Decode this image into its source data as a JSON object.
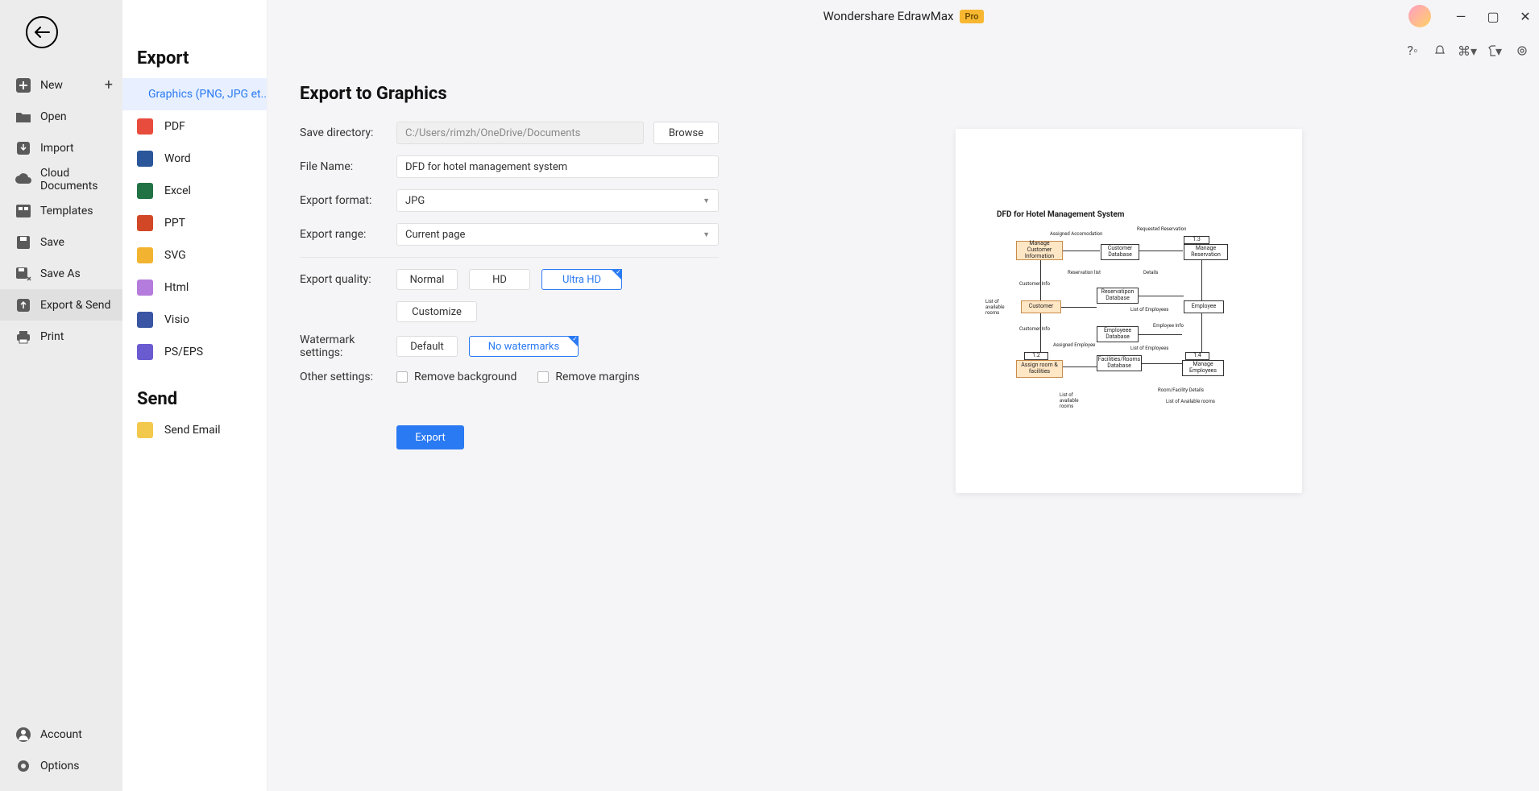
{
  "app": {
    "title": "Wondershare EdrawMax",
    "badge": "Pro"
  },
  "nav": {
    "items": [
      {
        "label": "New",
        "icon": "plus-square"
      },
      {
        "label": "Open",
        "icon": "folder"
      },
      {
        "label": "Import",
        "icon": "download"
      },
      {
        "label": "Cloud Documents",
        "icon": "cloud"
      },
      {
        "label": "Templates",
        "icon": "template"
      },
      {
        "label": "Save",
        "icon": "save"
      },
      {
        "label": "Save As",
        "icon": "save-as"
      },
      {
        "label": "Export & Send",
        "icon": "export",
        "active": true
      },
      {
        "label": "Print",
        "icon": "print"
      }
    ],
    "bottom": [
      {
        "label": "Account",
        "icon": "user"
      },
      {
        "label": "Options",
        "icon": "gear"
      }
    ]
  },
  "export_sidebar": {
    "heading": "Export",
    "formats": [
      {
        "label": "Graphics (PNG, JPG et...",
        "active": true
      },
      {
        "label": "PDF"
      },
      {
        "label": "Word"
      },
      {
        "label": "Excel"
      },
      {
        "label": "PPT"
      },
      {
        "label": "SVG"
      },
      {
        "label": "Html"
      },
      {
        "label": "Visio"
      },
      {
        "label": "PS/EPS"
      }
    ],
    "send_heading": "Send",
    "send_items": [
      {
        "label": "Send Email"
      }
    ]
  },
  "form": {
    "title": "Export to Graphics",
    "labels": {
      "save_dir": "Save directory:",
      "file_name": "File Name:",
      "export_format": "Export format:",
      "export_range": "Export range:",
      "export_quality": "Export quality:",
      "watermark": "Watermark settings:",
      "other": "Other settings:"
    },
    "values": {
      "save_dir": "C:/Users/rimzh/OneDrive/Documents",
      "file_name": "DFD for hotel management system",
      "export_format": "JPG",
      "export_range": "Current page"
    },
    "buttons": {
      "browse": "Browse",
      "customize": "Customize",
      "export": "Export"
    },
    "quality_options": {
      "normal": "Normal",
      "hd": "HD",
      "ultra_hd": "Ultra HD"
    },
    "watermark_options": {
      "default": "Default",
      "none": "No watermarks"
    },
    "checkboxes": {
      "remove_bg": "Remove background",
      "remove_margins": "Remove margins"
    }
  },
  "preview": {
    "title": "DFD for Hotel Management System",
    "boxes": {
      "manage_customer": "Manage Customer Information",
      "customer_db": "Customer Database",
      "manage_reservation": "Manage Reservation",
      "customer": "Customer",
      "reservation_db": "Reservatipon Database",
      "employee": "Employee",
      "employee_db": "Employeee Database",
      "assign_room": "Assign room & facilities",
      "facilities_db": "Facilities/Rooms Database",
      "manage_employees": "Manage Employees",
      "p13": "1.3",
      "p12": "1.2",
      "p14": "1.4"
    },
    "labels": {
      "assigned_accom": "Assigned Accomodation",
      "requested_res": "Requested Reservation",
      "reservation_list": "Reservation list",
      "customer_info1": "Customer Info",
      "customer_info2": "Customer Info",
      "details": "Details",
      "list_avail_rooms1": "List of available rooms",
      "list_employees1": "List of Employees",
      "list_employees2": "List of Employees",
      "employee_info": "Employee Info",
      "assigned_employee": "Assigned Employee",
      "room_facility": "Room/Facility Details",
      "list_avail_rooms2": "List of Available rooms",
      "list_avail_rooms3": "List of available rooms"
    }
  }
}
